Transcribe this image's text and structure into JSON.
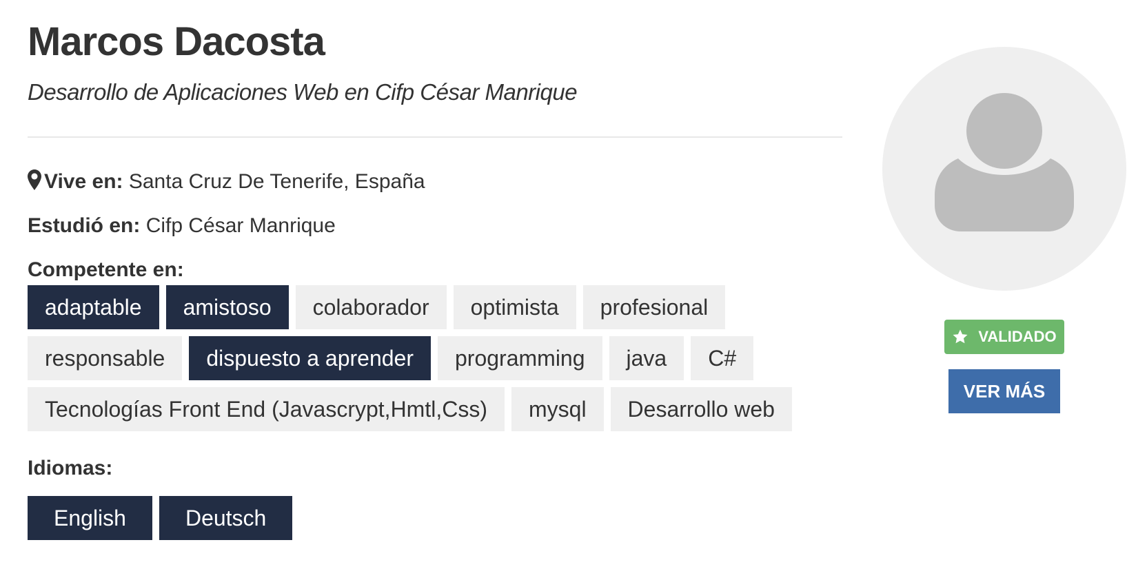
{
  "profile": {
    "name": "Marcos Dacosta",
    "subtitle": "Desarrollo de Aplicaciones Web en Cifp César Manrique",
    "lives_label": "Vive en:",
    "lives_value": "Santa Cruz De Tenerife, España",
    "studied_label": "Estudió en:",
    "studied_value": "Cifp César Manrique",
    "competent_label": "Competente en:",
    "languages_label": "Idiomas:"
  },
  "skills": [
    {
      "label": "adaptable",
      "highlighted": true
    },
    {
      "label": "amistoso",
      "highlighted": true
    },
    {
      "label": "colaborador",
      "highlighted": false
    },
    {
      "label": "optimista",
      "highlighted": false
    },
    {
      "label": "profesional",
      "highlighted": false
    },
    {
      "label": "responsable",
      "highlighted": false
    },
    {
      "label": "dispuesto a aprender",
      "highlighted": true
    },
    {
      "label": "programming",
      "highlighted": false
    },
    {
      "label": "java",
      "highlighted": false
    },
    {
      "label": "C#",
      "highlighted": false
    },
    {
      "label": "Tecnologías Front End (Javascrypt,Hmtl,Css)",
      "highlighted": false
    },
    {
      "label": "mysql",
      "highlighted": false
    },
    {
      "label": "Desarrollo web",
      "highlighted": false
    }
  ],
  "languages": [
    "English",
    "Deutsch"
  ],
  "sidebar": {
    "avatar_icon": "default-user-avatar",
    "validated_icon": "star-icon",
    "validated_label": "VALIDADO",
    "more_button_label": "VER MÁS"
  },
  "colors": {
    "dark_tag": "#222d44",
    "light_tag": "#efefef",
    "validated_green": "#6db86b",
    "button_blue": "#3e6daa",
    "text": "#333333"
  }
}
